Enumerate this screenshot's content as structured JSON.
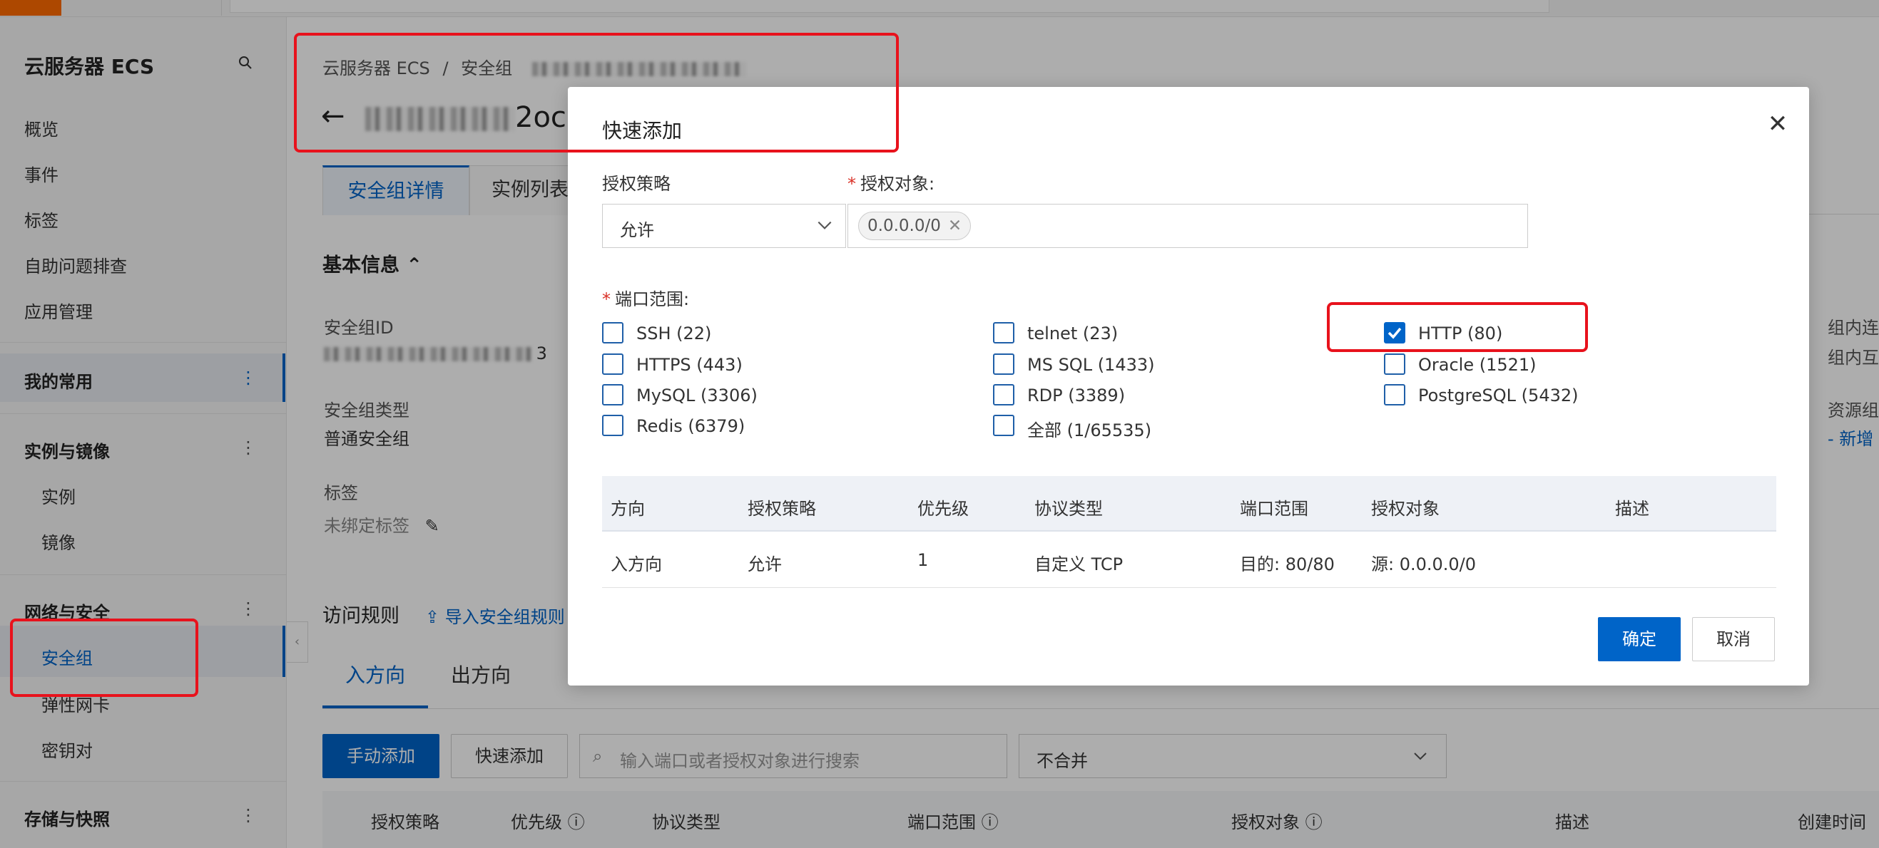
{
  "sidebar": {
    "title": "云服务器 ECS",
    "items": [
      {
        "label": "概览"
      },
      {
        "label": "事件"
      },
      {
        "label": "标签"
      },
      {
        "label": "自助问题排查"
      },
      {
        "label": "应用管理"
      }
    ],
    "groups": {
      "common": "我的常用",
      "instances": "实例与镜像",
      "instances_items": [
        "实例",
        "镜像"
      ],
      "network": "网络与安全",
      "network_items": [
        "安全组",
        "弹性网卡",
        "密钥对"
      ],
      "storage": "存储与快照"
    },
    "collapse_glyph": "‹"
  },
  "main": {
    "breadcrumb": {
      "root": "云服务器 ECS",
      "sep": "/",
      "current": "安全组"
    },
    "title_suffix": "2oc",
    "tabs": [
      "安全组详情",
      "实例列表"
    ],
    "basic_info": {
      "heading": "基本信息",
      "sg_id_label": "安全组ID",
      "sg_id_suffix": "3",
      "sg_type_label": "安全组类型",
      "sg_type_value": "普通安全组",
      "tag_label": "标签",
      "tag_value": "未绑定标签",
      "right_col": [
        "组内连",
        "组内互",
        "资源组",
        "-  新增"
      ]
    },
    "access_rules": {
      "heading": "访问规则",
      "import_link": "导入安全组规则",
      "subtabs": [
        "入方向",
        "出方向"
      ],
      "manual_add": "手动添加",
      "quick_add": "快速添加",
      "search_placeholder": "输入端口或者授权对象进行搜索",
      "merge_select": "不合并",
      "columns": [
        "授权策略",
        "优先级",
        "协议类型",
        "端口范围",
        "授权对象",
        "描述",
        "创建时间"
      ]
    }
  },
  "modal": {
    "title": "快速添加",
    "policy_label": "授权策略",
    "policy_value": "允许",
    "target_label": "授权对象:",
    "target_tag": "0.0.0.0/0",
    "port_label": "端口范围:",
    "ports": [
      {
        "label": "SSH (22)",
        "checked": false
      },
      {
        "label": "telnet (23)",
        "checked": false
      },
      {
        "label": "HTTP (80)",
        "checked": true
      },
      {
        "label": "HTTPS (443)",
        "checked": false
      },
      {
        "label": "MS SQL (1433)",
        "checked": false
      },
      {
        "label": "Oracle (1521)",
        "checked": false
      },
      {
        "label": "MySQL (3306)",
        "checked": false
      },
      {
        "label": "RDP (3389)",
        "checked": false
      },
      {
        "label": "PostgreSQL (5432)",
        "checked": false
      },
      {
        "label": "Redis (6379)",
        "checked": false
      },
      {
        "label": "全部 (1/65535)",
        "checked": false
      }
    ],
    "table": {
      "columns": [
        "方向",
        "授权策略",
        "优先级",
        "协议类型",
        "端口范围",
        "授权对象",
        "描述"
      ],
      "row": [
        "入方向",
        "允许",
        "1",
        "自定义 TCP",
        "目的: 80/80",
        "源: 0.0.0.0/0",
        ""
      ]
    },
    "confirm": "确定",
    "cancel": "取消",
    "close_glyph": "✕"
  },
  "colors": {
    "accent": "#0064c8",
    "highlight": "#e8121c",
    "brand": "#ff6a00"
  }
}
